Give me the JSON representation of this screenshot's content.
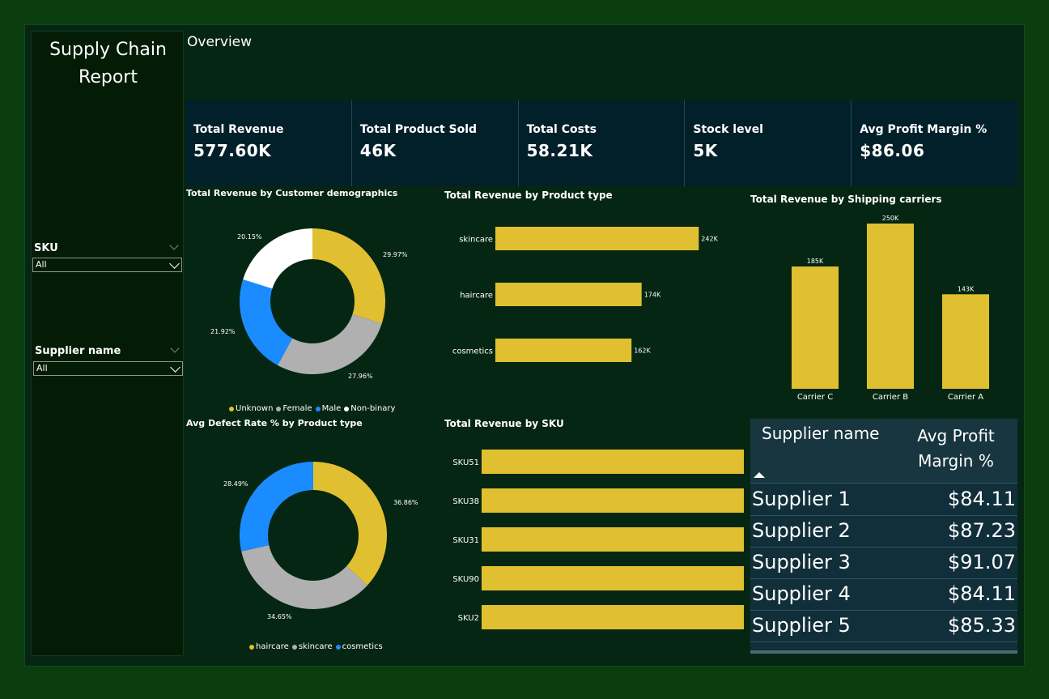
{
  "sidebar": {
    "title_line1": "Supply Chain",
    "title_line2": "Report",
    "sku_label": "SKU",
    "sku_value": "All",
    "supplier_label": "Supplier name",
    "supplier_value": "All"
  },
  "page_title": "Overview",
  "kpis": [
    {
      "label": "Total Revenue",
      "value": "577.60K"
    },
    {
      "label": "Total Product Sold",
      "value": "46K"
    },
    {
      "label": "Total Costs",
      "value": "58.21K"
    },
    {
      "label": "Stock level",
      "value": "5K"
    },
    {
      "label": "Avg Profit Margin %",
      "value": "$86.06"
    }
  ],
  "colors": {
    "yellow": "#e0c030",
    "gray": "#b0b0b0",
    "blue": "#1a8cff",
    "white": "#ffffff"
  },
  "chart_data": [
    {
      "type": "pie",
      "title": "Total Revenue by Customer demographics",
      "categories": [
        "Unknown",
        "Female",
        "Male",
        "Non-binary"
      ],
      "values": [
        29.97,
        27.96,
        21.92,
        20.15
      ],
      "labels": [
        "29.97%",
        "27.96%",
        "21.92%",
        "20.15%"
      ],
      "colors": [
        "#e0c030",
        "#b0b0b0",
        "#1a8cff",
        "#ffffff"
      ],
      "legend": "bottom"
    },
    {
      "type": "bar",
      "orientation": "horizontal",
      "title": "Total Revenue by Product type",
      "categories": [
        "skincare",
        "haircare",
        "cosmetics"
      ],
      "values": [
        242,
        174,
        162
      ],
      "labels": [
        "242K",
        "174K",
        "162K"
      ],
      "xlim": [
        0,
        260
      ]
    },
    {
      "type": "bar",
      "title": "Total Revenue by Shipping carriers",
      "categories": [
        "Carrier C",
        "Carrier B",
        "Carrier A"
      ],
      "values": [
        185,
        250,
        143
      ],
      "labels": [
        "185K",
        "250K",
        "143K"
      ],
      "ylim": [
        0,
        250
      ]
    },
    {
      "type": "pie",
      "title": "Avg Defect Rate % by Product type",
      "categories": [
        "haircare",
        "skincare",
        "cosmetics"
      ],
      "values": [
        36.86,
        34.65,
        28.49
      ],
      "labels": [
        "36.86%",
        "34.65%",
        "28.49%"
      ],
      "colors": [
        "#e0c030",
        "#b0b0b0",
        "#1a8cff"
      ],
      "legend": "bottom"
    },
    {
      "type": "bar",
      "orientation": "horizontal",
      "title": "Total Revenue by SKU",
      "categories": [
        "SKU51",
        "SKU38",
        "SKU31",
        "SKU90",
        "SKU2"
      ],
      "values": [
        9.9,
        9.7,
        9.7,
        9.6,
        9.6
      ],
      "labels": [
        "9.9K",
        "9.7K",
        "9.7K",
        "9.6K",
        "9.6K"
      ],
      "xlim": [
        0,
        10
      ]
    }
  ],
  "table": {
    "col1": "Supplier name",
    "col2": "Avg Profit Margin %",
    "rows": [
      {
        "name": "Supplier 1",
        "value": "$84.11"
      },
      {
        "name": "Supplier 2",
        "value": "$87.23"
      },
      {
        "name": "Supplier 3",
        "value": "$91.07"
      },
      {
        "name": "Supplier 4",
        "value": "$84.11"
      },
      {
        "name": "Supplier 5",
        "value": "$85.33"
      }
    ]
  }
}
